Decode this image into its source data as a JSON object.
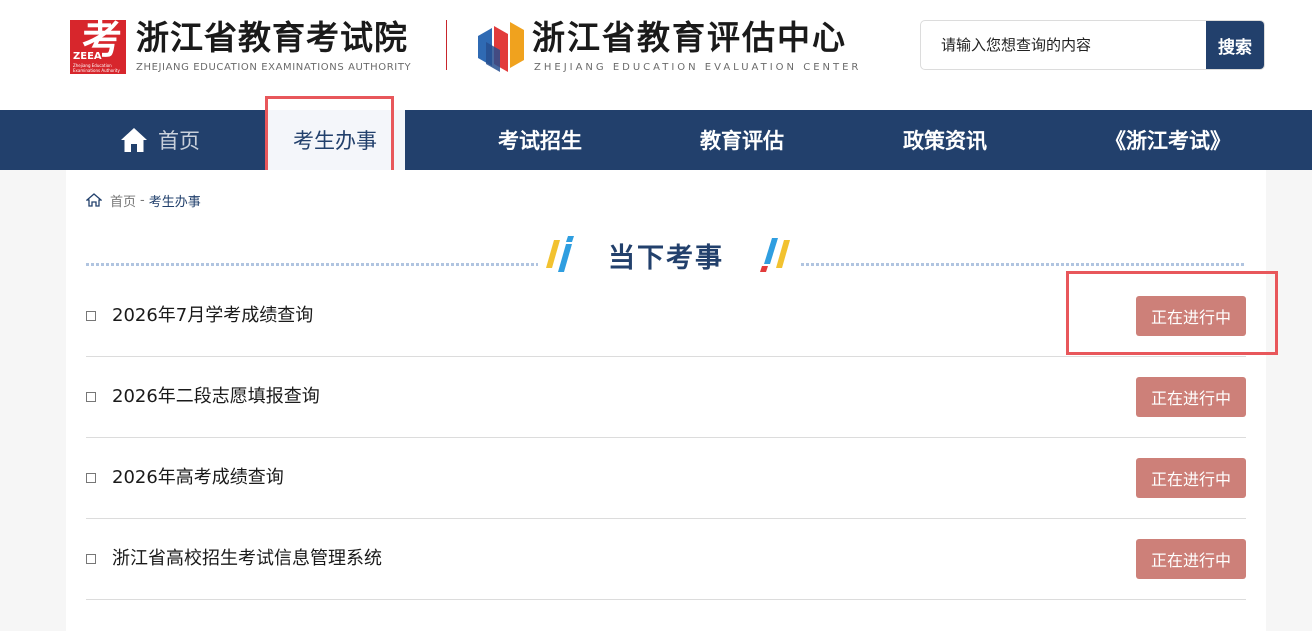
{
  "header": {
    "logo1": {
      "mark_char": "考",
      "mark_text": "ZEEA",
      "mark_tiny": "Zhejiang Education Examinations Authority",
      "title": "浙江省教育考试院",
      "subtitle": "ZHEJIANG EDUCATION EXAMINATIONS AUTHORITY"
    },
    "logo2": {
      "title": "浙江省教育评估中心",
      "subtitle": "ZHEJIANG EDUCATION EVALUATION CENTER"
    },
    "search": {
      "placeholder": "请输入您想查询的内容",
      "button_label": "搜索"
    }
  },
  "nav": {
    "items": [
      {
        "label": "首页"
      },
      {
        "label": "考生办事"
      },
      {
        "label": "考试招生"
      },
      {
        "label": "教育评估"
      },
      {
        "label": "政策资讯"
      },
      {
        "label": "《浙江考试》"
      }
    ],
    "active_index": 1
  },
  "breadcrumb": {
    "home": "首页",
    "separator": "-",
    "current": "考生办事"
  },
  "section": {
    "title": "当下考事",
    "items": [
      {
        "title": "2026年7月学考成绩查询",
        "status": "正在进行中"
      },
      {
        "title": "2026年二段志愿填报查询",
        "status": "正在进行中"
      },
      {
        "title": "2026年高考成绩查询",
        "status": "正在进行中"
      },
      {
        "title": "浙江省高校招生考试信息管理系统",
        "status": "正在进行中"
      }
    ]
  },
  "colors": {
    "nav_bg": "#22406c",
    "status_bg": "#cd8079",
    "highlight": "#e8575b",
    "logo_red": "#d7262c"
  }
}
